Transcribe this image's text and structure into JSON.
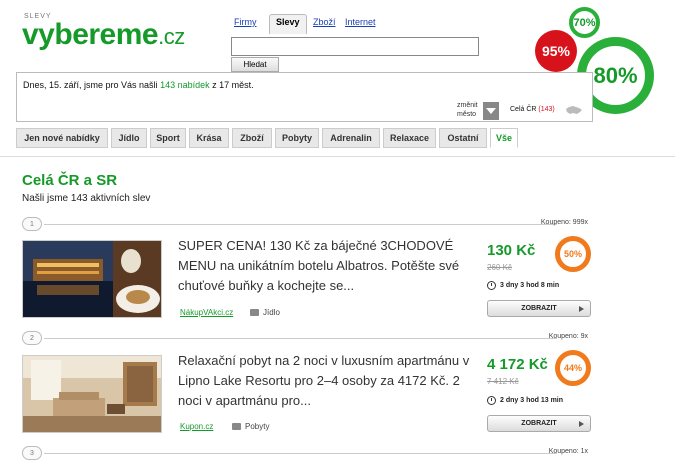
{
  "brand": {
    "small": "SLEVY",
    "name": "vybereme",
    "tld": ".cz"
  },
  "search": {
    "tabs": [
      "Firmy",
      "Slevy",
      "Zboží",
      "Internet"
    ],
    "active_tab": "Slevy",
    "value": "",
    "button_label": "Hledat"
  },
  "badges": {
    "small": "70%",
    "red": "95%",
    "big": "80%"
  },
  "info": {
    "prefix": "Dnes, 15. září, jsme pro Vás našli ",
    "count": "143 nabídek",
    "suffix": " z 17 měst.",
    "change_label_1": "změnit",
    "change_label_2": "město",
    "region": "Celá ČR",
    "region_count": "(143)"
  },
  "categories": [
    "Jen nové nabídky",
    "Jídlo",
    "Sport",
    "Krása",
    "Zboží",
    "Pobyty",
    "Adrenalin",
    "Relaxace",
    "Ostatní",
    "Vše"
  ],
  "active_category": "Vše",
  "page": {
    "title": "Celá ČR a SR",
    "subtitle": "Našli jsme 143 aktivních slev"
  },
  "deals": [
    {
      "num": "1",
      "bought": "Koupeno: 999x",
      "description": "SUPER CENA! 130 Kč za báječné 3CHODOVÉ MENU na unikátním botelu Albatros. Potěšte své chuťové buňky a kochejte se...",
      "price": "130 Kč",
      "old_price": "260 Kč",
      "discount": "50%",
      "time_left": "3 dny 3 hod 8 min",
      "source": "NákupVAkci.cz",
      "category": "Jídlo",
      "button": "ZOBRAZIT"
    },
    {
      "num": "2",
      "bought": "Koupeno: 9x",
      "description": "Relaxační pobyt na 2 noci v luxusním apartmánu v Lipno Lake Resortu pro 2–4 osoby za 4172 Kč. 2 noci v apartmánu pro...",
      "price": "4 172 Kč",
      "old_price": "7 412 Kč",
      "discount": "44%",
      "time_left": "2 dny 3 hod 13 min",
      "source": "Kupon.cz",
      "category": "Pobyty",
      "button": "ZOBRAZIT"
    },
    {
      "num": "3",
      "bought": "Koupeno: 1x"
    }
  ],
  "colors": {
    "brand_green": "#159a2a",
    "badge_red": "#d8121b",
    "discount_orange": "#f07a1c"
  }
}
